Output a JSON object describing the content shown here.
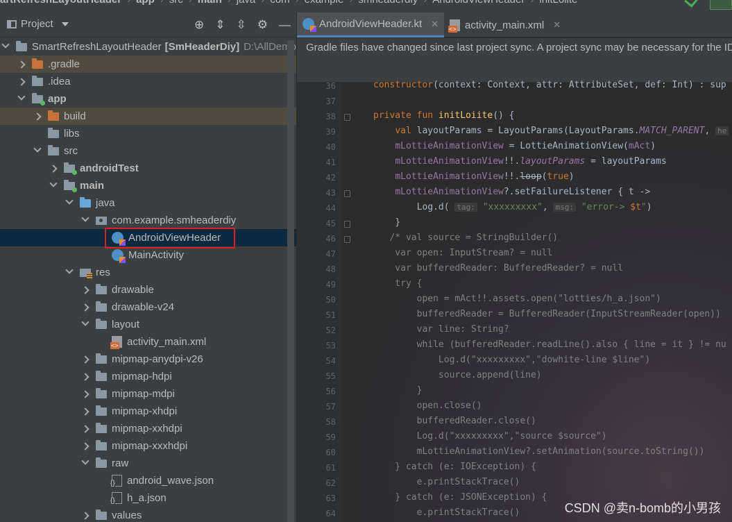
{
  "breadcrumb": [
    "artRefreshLayoutHeader",
    "app",
    "src",
    "main",
    "java",
    "com",
    "example",
    "smheaderdiy",
    "AndroidViewHeader",
    "initLoiite"
  ],
  "project_pane": {
    "title": "Project",
    "tree": [
      {
        "label": "SmartRefreshLayoutHeader",
        "extra_bold": "[SmHeaderDiy]",
        "extra": "D:\\AllDemo",
        "depth": 0,
        "arrow": "down",
        "icon": "folder"
      },
      {
        "label": ".gradle",
        "depth": 1,
        "arrow": "right",
        "icon": "folder-orange",
        "highlight": true
      },
      {
        "label": ".idea",
        "depth": 1,
        "arrow": "right",
        "icon": "folder"
      },
      {
        "label": "app",
        "depth": 1,
        "arrow": "down",
        "icon": "folder-dot",
        "bold": true
      },
      {
        "label": "build",
        "depth": 2,
        "arrow": "right",
        "icon": "folder-orange",
        "highlight": true
      },
      {
        "label": "libs",
        "depth": 2,
        "arrow": "none",
        "icon": "folder"
      },
      {
        "label": "src",
        "depth": 2,
        "arrow": "down",
        "icon": "folder"
      },
      {
        "label": "androidTest",
        "depth": 3,
        "arrow": "right",
        "icon": "folder-dot",
        "bold": true
      },
      {
        "label": "main",
        "depth": 3,
        "arrow": "down",
        "icon": "folder-dot",
        "bold": true
      },
      {
        "label": "java",
        "depth": 4,
        "arrow": "down",
        "icon": "folder-blue"
      },
      {
        "label": "com.example.smheaderdiy",
        "depth": 5,
        "arrow": "down",
        "icon": "package"
      },
      {
        "label": "AndroidViewHeader",
        "depth": 6,
        "arrow": "none",
        "icon": "kotlin",
        "selected": true
      },
      {
        "label": "MainActivity",
        "depth": 6,
        "arrow": "none",
        "icon": "kotlin"
      },
      {
        "label": "res",
        "depth": 4,
        "arrow": "down",
        "icon": "res"
      },
      {
        "label": "drawable",
        "depth": 5,
        "arrow": "right",
        "icon": "folder"
      },
      {
        "label": "drawable-v24",
        "depth": 5,
        "arrow": "right",
        "icon": "folder"
      },
      {
        "label": "layout",
        "depth": 5,
        "arrow": "down",
        "icon": "folder"
      },
      {
        "label": "activity_main.xml",
        "depth": 6,
        "arrow": "none",
        "icon": "xml"
      },
      {
        "label": "mipmap-anydpi-v26",
        "depth": 5,
        "arrow": "right",
        "icon": "folder"
      },
      {
        "label": "mipmap-hdpi",
        "depth": 5,
        "arrow": "right",
        "icon": "folder"
      },
      {
        "label": "mipmap-mdpi",
        "depth": 5,
        "arrow": "right",
        "icon": "folder"
      },
      {
        "label": "mipmap-xhdpi",
        "depth": 5,
        "arrow": "right",
        "icon": "folder"
      },
      {
        "label": "mipmap-xxhdpi",
        "depth": 5,
        "arrow": "right",
        "icon": "folder"
      },
      {
        "label": "mipmap-xxxhdpi",
        "depth": 5,
        "arrow": "right",
        "icon": "folder"
      },
      {
        "label": "raw",
        "depth": 5,
        "arrow": "down",
        "icon": "folder"
      },
      {
        "label": "android_wave.json",
        "depth": 6,
        "arrow": "none",
        "icon": "json"
      },
      {
        "label": "h_a.json",
        "depth": 6,
        "arrow": "none",
        "icon": "json"
      },
      {
        "label": "values",
        "depth": 5,
        "arrow": "right",
        "icon": "folder"
      }
    ]
  },
  "editor": {
    "tabs": [
      {
        "label": "AndroidViewHeader.kt",
        "icon": "kotlin",
        "active": true
      },
      {
        "label": "activity_main.xml",
        "icon": "xml",
        "active": false
      }
    ],
    "notice": "Gradle files have changed since last project sync. A project sync may be necessary for the IDE",
    "lines": [
      {
        "n": "36",
        "html": "<span class='kw'>constructor</span>(context: Context, attr: AttributeSet, def: Int) : sup"
      },
      {
        "n": "37",
        "html": ""
      },
      {
        "n": "38",
        "html": "<span class='kw'>private fun </span><span class='fn'>initLoiite</span>() {"
      },
      {
        "n": "39",
        "html": "    <span class='kw'>val </span>layoutParams = LayoutParams(LayoutParams.<span class='const'>MATCH_PARENT</span>, <span class='hint'>he</span>"
      },
      {
        "n": "40",
        "html": "    <span class='prop'>mLottieAnimationView</span> = LottieAnimationView(<span class='prop'>mAct</span>)"
      },
      {
        "n": "41",
        "html": "    <span class='prop'>mLottieAnimationView</span>!!.<span class='prop'><i>layoutParams</i></span> = layoutParams"
      },
      {
        "n": "42",
        "html": "    <span class='prop'>mLottieAnimationView</span>!!.<s>loop</s>(<span class='kw'>true</span>)"
      },
      {
        "n": "43",
        "html": "    <span class='prop'>mLottieAnimationView</span>?.setFailureListener { t ->"
      },
      {
        "n": "44",
        "html": "        Log.d( <span class='hint'>tag:</span> <span class='str'>\"xxxxxxxxx\"</span>, <span class='hint'>msg:</span> <span class='str'>\"error-> </span><span class='kw'>$t</span><span class='str'>\"</span>)"
      },
      {
        "n": "45",
        "html": "    }"
      },
      {
        "n": "46",
        "html": "   <span class='cmt'>/* val source = StringBuilder()</span>"
      },
      {
        "n": "47",
        "html": "<span class='cmt'>    var open: InputStream? = null</span>"
      },
      {
        "n": "48",
        "html": "<span class='cmt'>    var bufferedReader: BufferedReader? = null</span>"
      },
      {
        "n": "49",
        "html": "<span class='cmt'>    try {</span>"
      },
      {
        "n": "50",
        "html": "<span class='cmt'>        open = mAct!!.assets.open(\"lotties/h_a.json\")</span>"
      },
      {
        "n": "51",
        "html": "<span class='cmt'>        bufferedReader = BufferedReader(InputStreamReader(open))</span>"
      },
      {
        "n": "52",
        "html": "<span class='cmt'>        var line: String?</span>"
      },
      {
        "n": "53",
        "html": "<span class='cmt'>        while (bufferedReader.readLine().also { line = it } != nu</span>"
      },
      {
        "n": "54",
        "html": "<span class='cmt'>            Log.d(\"xxxxxxxxx\",\"dowhite-line $line\")</span>"
      },
      {
        "n": "55",
        "html": "<span class='cmt'>            source.append(line)</span>"
      },
      {
        "n": "56",
        "html": "<span class='cmt'>        }</span>"
      },
      {
        "n": "57",
        "html": "<span class='cmt'>        open.close()</span>"
      },
      {
        "n": "58",
        "html": "<span class='cmt'>        bufferedReader.close()</span>"
      },
      {
        "n": "59",
        "html": "<span class='cmt'>        Log.d(\"xxxxxxxxx\",\"source $source\")</span>"
      },
      {
        "n": "60",
        "html": "<span class='cmt'>        mLottieAnimationView?.setAnimation(source.toString())</span>"
      },
      {
        "n": "61",
        "html": "<span class='cmt'>    } catch (e: IOException) {</span>"
      },
      {
        "n": "62",
        "html": "<span class='cmt'>        e.printStackTrace()</span>"
      },
      {
        "n": "63",
        "html": "<span class='cmt'>    } catch (e: JSONException) {</span>"
      },
      {
        "n": "64",
        "html": "<span class='cmt'>        e.printStackTrace()</span>"
      }
    ]
  },
  "watermark": "CSDN @卖n-bomb的小男孩",
  "colors": {
    "selection": "#0d293e",
    "highlight_row": "#504b3f",
    "red_box": "#e02020",
    "accent": "#4a88c7"
  }
}
